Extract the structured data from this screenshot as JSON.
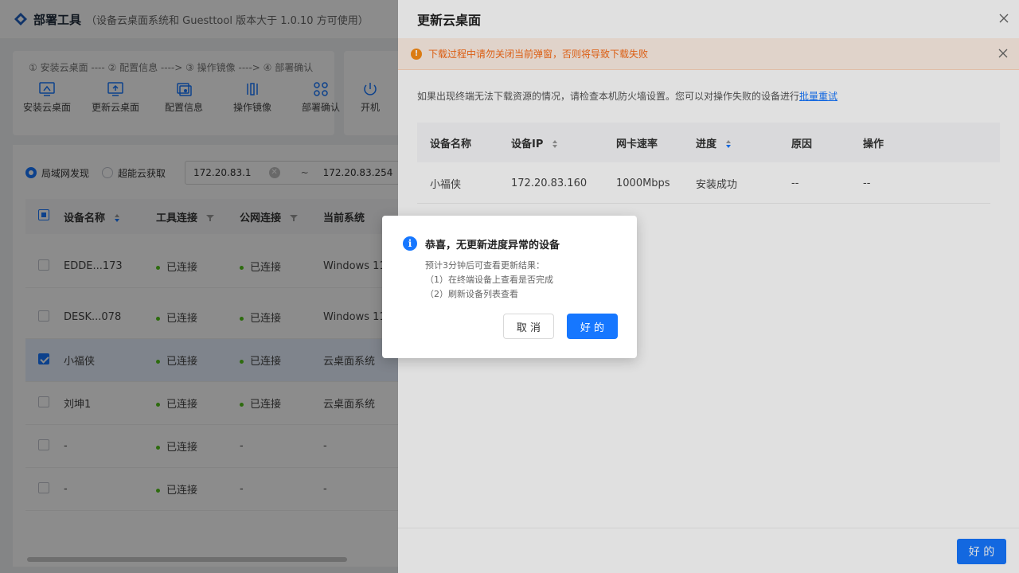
{
  "app": {
    "title": "部署工具",
    "subtitle": "（设备云桌面系统和 Guesttool 版本大于 1.0.10 方可使用）"
  },
  "steps": "① 安装云桌面 ---- ② 配置信息 ----> ③ 操作镜像 ----> ④ 部署确认",
  "toolbar": {
    "install": "安装云桌面",
    "update": "更新云桌面",
    "config": "配置信息",
    "image": "操作镜像",
    "deploy": "部署确认",
    "power_on": "开机"
  },
  "filter": {
    "lan": "局域网发现",
    "cloud": "超能云获取",
    "ip_start": "172.20.83.1",
    "tilde": "~",
    "ip_end": "172.20.83.254"
  },
  "device_table": {
    "headers": {
      "name": "设备名称",
      "tool": "工具连接",
      "public": "公网连接",
      "system": "当前系统"
    },
    "rows": [
      {
        "name": "EDDE...173",
        "tool": "已连接",
        "public": "已连接",
        "system": "Windows 11"
      },
      {
        "name": "DESK...078",
        "tool": "已连接",
        "public": "已连接",
        "system": "Windows 11"
      },
      {
        "name": "小福侠",
        "tool": "已连接",
        "public": "已连接",
        "system": "云桌面系统"
      },
      {
        "name": "刘坤1",
        "tool": "已连接",
        "public": "已连接",
        "system": "云桌面系统"
      },
      {
        "name": "-",
        "tool": "已连接",
        "public": "-",
        "system": "-"
      },
      {
        "name": "-",
        "tool": "已连接",
        "public": "-",
        "system": "-"
      }
    ]
  },
  "drawer": {
    "title": "更新云桌面",
    "alert": "下载过程中请勿关闭当前弹窗，否则将导致下载失败",
    "hint": "如果出现终端无法下载资源的情况，请检查本机防火墙设置。您可以对操作失败的设备进行",
    "hint_link": "批量重试",
    "headers": {
      "name": "设备名称",
      "ip": "设备IP",
      "speed": "网卡速率",
      "progress": "进度",
      "reason": "原因",
      "action": "操作"
    },
    "row": {
      "name": "小福侠",
      "ip": "172.20.83.160",
      "speed": "1000Mbps",
      "progress": "安装成功",
      "reason": "--",
      "action": "--"
    },
    "ok": "好 的"
  },
  "modal": {
    "title": "恭喜，无更新进度异常的设备",
    "line1": "预计3分钟后可查看更新结果：",
    "line2": "（1）在终端设备上查看是否完成",
    "line3": "（2）刷新设备列表查看",
    "cancel": "取 消",
    "ok": "好 的"
  },
  "colors": {
    "primary": "#1677ff",
    "warning": "#fa8c16",
    "success": "#52c41a"
  }
}
